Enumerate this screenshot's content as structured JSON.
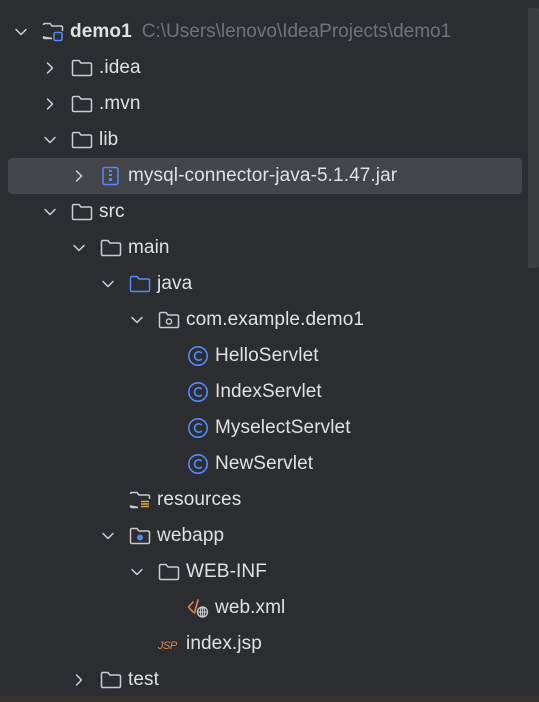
{
  "project": {
    "name": "demo1",
    "path": "C:\\Users\\lenovo\\IdeaProjects\\demo1"
  },
  "colors": {
    "background": "#2b2d30",
    "selection": "#43454a",
    "text": "#dfe1e5",
    "muted": "#6f737a",
    "folder_icon": "#c9ccd1",
    "source_folder_icon": "#548af7",
    "class_icon": "#548af7",
    "xml_icon": "#e08855",
    "jsp_icon": "#e08855"
  },
  "tree": [
    {
      "label": "demo1",
      "depth": 0,
      "expand": "open",
      "icon": "module-folder-icon",
      "bold": true,
      "has_path": true
    },
    {
      "label": ".idea",
      "depth": 1,
      "expand": "closed",
      "icon": "folder-icon"
    },
    {
      "label": ".mvn",
      "depth": 1,
      "expand": "closed",
      "icon": "folder-icon"
    },
    {
      "label": "lib",
      "depth": 1,
      "expand": "open",
      "icon": "folder-icon"
    },
    {
      "label": "mysql-connector-java-5.1.47.jar",
      "depth": 2,
      "expand": "closed",
      "icon": "jar-icon",
      "selected": true
    },
    {
      "label": "src",
      "depth": 1,
      "expand": "open",
      "icon": "folder-icon"
    },
    {
      "label": "main",
      "depth": 2,
      "expand": "open",
      "icon": "folder-icon"
    },
    {
      "label": "java",
      "depth": 3,
      "expand": "open",
      "icon": "source-folder-icon"
    },
    {
      "label": "com.example.demo1",
      "depth": 4,
      "expand": "open",
      "icon": "package-icon"
    },
    {
      "label": "HelloServlet",
      "depth": 5,
      "expand": "none",
      "icon": "class-icon"
    },
    {
      "label": "IndexServlet",
      "depth": 5,
      "expand": "none",
      "icon": "class-icon"
    },
    {
      "label": "MyselectServlet",
      "depth": 5,
      "expand": "none",
      "icon": "class-icon"
    },
    {
      "label": "NewServlet",
      "depth": 5,
      "expand": "none",
      "icon": "class-icon"
    },
    {
      "label": "resources",
      "depth": 3,
      "expand": "none",
      "icon": "resources-folder-icon"
    },
    {
      "label": "webapp",
      "depth": 3,
      "expand": "open",
      "icon": "web-folder-icon"
    },
    {
      "label": "WEB-INF",
      "depth": 4,
      "expand": "open",
      "icon": "folder-icon"
    },
    {
      "label": "web.xml",
      "depth": 5,
      "expand": "none",
      "icon": "xml-icon"
    },
    {
      "label": "index.jsp",
      "depth": 4,
      "expand": "none",
      "icon": "jsp-icon"
    },
    {
      "label": "test",
      "depth": 2,
      "expand": "closed",
      "icon": "folder-icon"
    }
  ]
}
